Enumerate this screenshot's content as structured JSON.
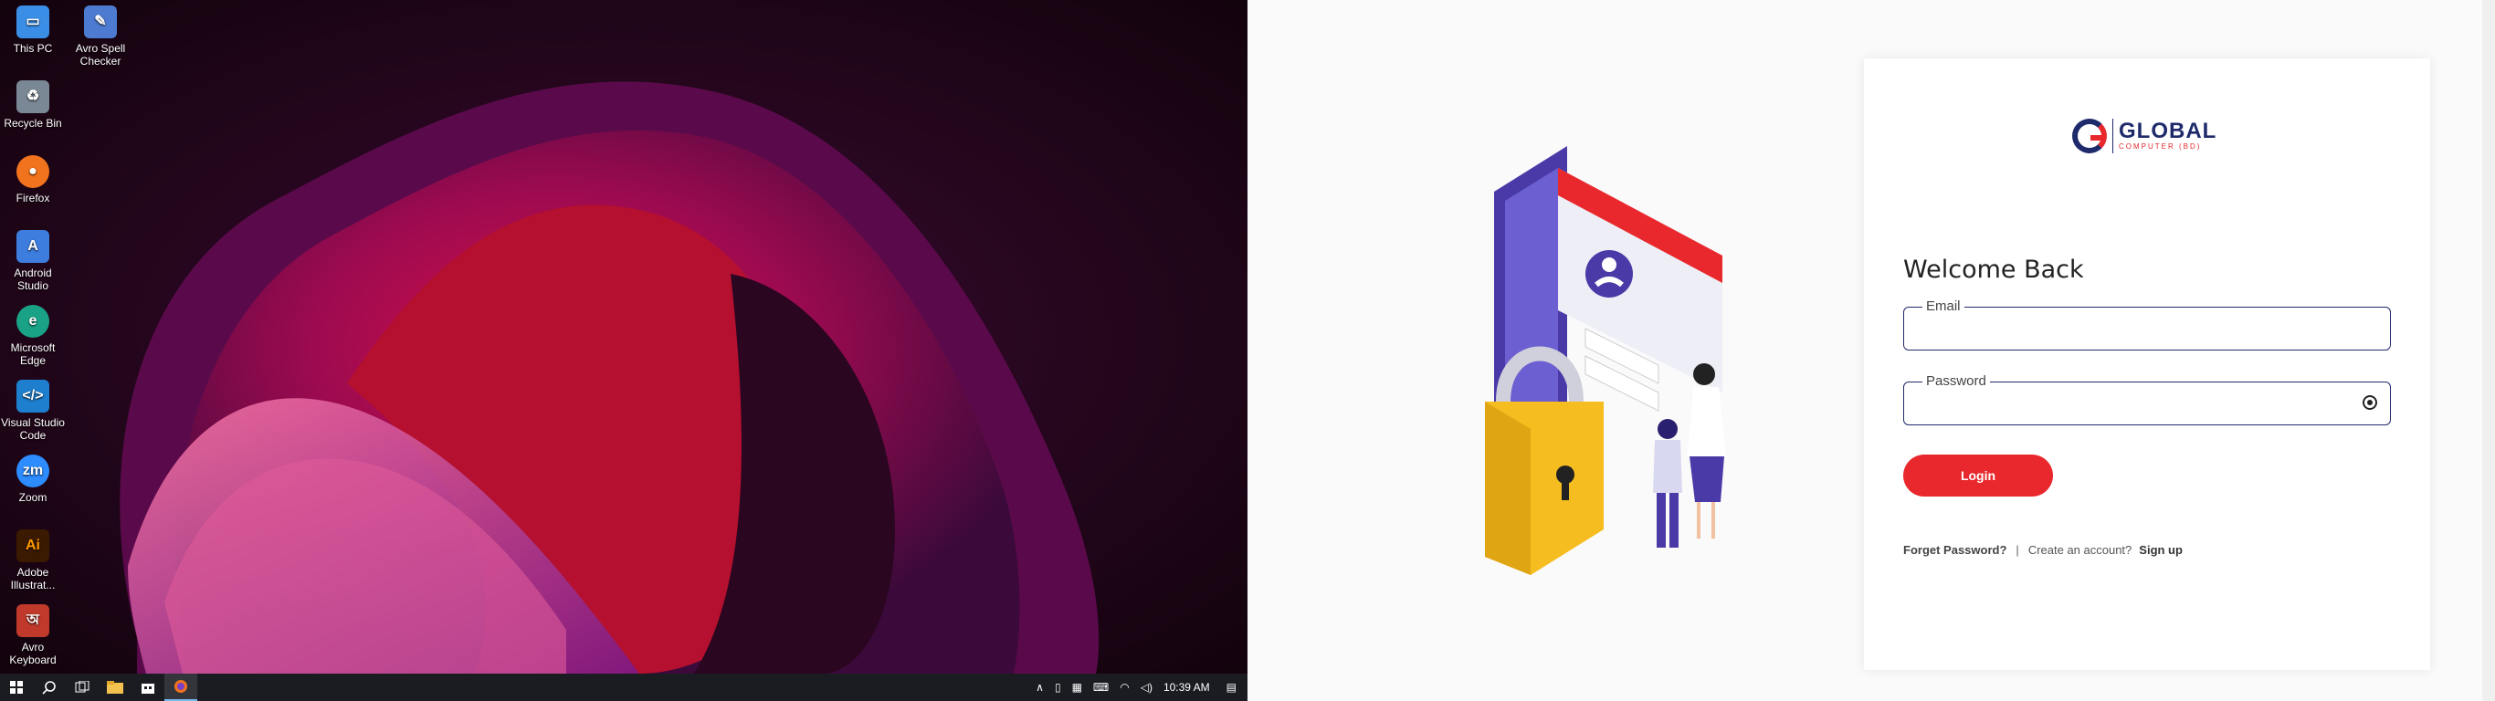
{
  "desktop": {
    "icons": [
      {
        "label": "This PC",
        "icon": "computer-icon",
        "color": "#3a8ee6"
      },
      {
        "label": "Avro Spell Checker",
        "icon": "spellcheck-icon",
        "color": "#4d7bd1"
      },
      {
        "label": "Recycle Bin",
        "icon": "recycle-bin-icon",
        "color": "#7a8794"
      },
      {
        "label": "Firefox",
        "icon": "firefox-icon",
        "color": "#f2731d"
      },
      {
        "label": "Android Studio",
        "icon": "android-studio-icon",
        "color": "#3d7dde"
      },
      {
        "label": "Microsoft Edge",
        "icon": "edge-icon",
        "color": "#1aa287"
      },
      {
        "label": "Visual Studio Code",
        "icon": "vscode-icon",
        "color": "#1e7fcf"
      },
      {
        "label": "Zoom",
        "icon": "zoom-icon",
        "color": "#2d8cff"
      },
      {
        "label": "Adobe Illustrat...",
        "icon": "illustrator-icon",
        "color": "#3a1a00"
      },
      {
        "label": "Avro Keyboard",
        "icon": "keyboard-icon",
        "color": "#c0392b"
      }
    ]
  },
  "taskbar": {
    "time": "10:39 AM"
  },
  "login": {
    "logo_main": "GLOBAL",
    "logo_sub": "COMPUTER (BD)",
    "welcome": "Welcome Back",
    "email_label": "Email",
    "password_label": "Password",
    "login_button": "Login",
    "forgot": "Forget Password?",
    "separator": "|",
    "create": "Create an account?",
    "signup": "Sign up",
    "colors": {
      "brand_red": "#e8282c",
      "brand_navy": "#1f2a6b"
    }
  }
}
